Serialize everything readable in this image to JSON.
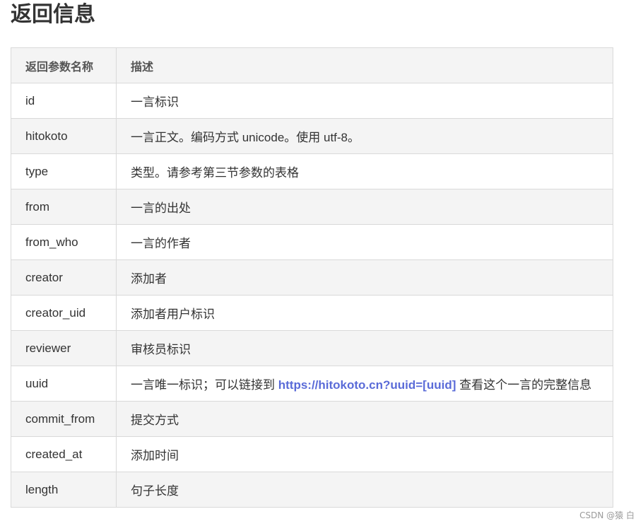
{
  "page": {
    "title": "返回信息"
  },
  "table": {
    "headers": {
      "name": "返回参数名称",
      "desc": "描述"
    },
    "rows": [
      {
        "name": "id",
        "desc": "一言标识"
      },
      {
        "name": "hitokoto",
        "desc": "一言正文。编码方式 unicode。使用 utf-8。"
      },
      {
        "name": "type",
        "desc": "类型。请参考第三节参数的表格"
      },
      {
        "name": "from",
        "desc": "一言的出处"
      },
      {
        "name": "from_who",
        "desc": "一言的作者"
      },
      {
        "name": "creator",
        "desc": "添加者"
      },
      {
        "name": "creator_uid",
        "desc": "添加者用户标识"
      },
      {
        "name": "reviewer",
        "desc": "审核员标识"
      },
      {
        "name": "uuid",
        "desc_before": "一言唯一标识；可以链接到 ",
        "link_text": "https://hitokoto.cn?uuid=[uuid]",
        "desc_after": " 查看这个一言的完整信息"
      },
      {
        "name": "commit_from",
        "desc": "提交方式"
      },
      {
        "name": "created_at",
        "desc": "添加时间"
      },
      {
        "name": "length",
        "desc": "句子长度"
      }
    ]
  },
  "watermark": "CSDN @猿 白",
  "colors": {
    "link": "#5a6bd8",
    "stripe": "#f4f4f4",
    "border": "#d9d9d9"
  }
}
